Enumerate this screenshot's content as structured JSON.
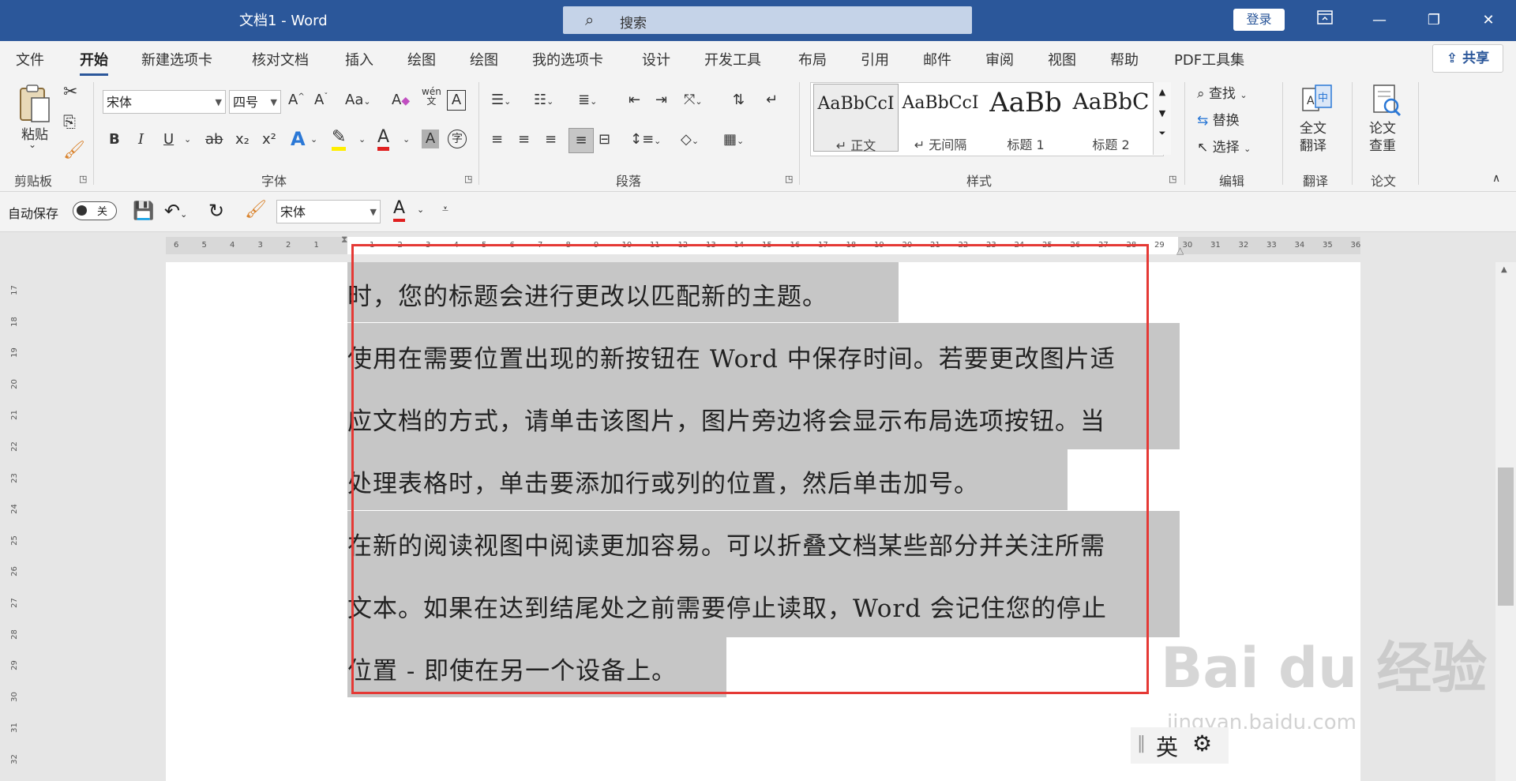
{
  "titlebar": {
    "doc_title": "文档1  -  Word",
    "search_placeholder": "搜索",
    "login": "登录",
    "ribbon_display_icon": "ribbon-display-icon",
    "minimize": "—",
    "restore": "❐",
    "close": "✕"
  },
  "tabs": [
    "文件",
    "开始",
    "新建选项卡",
    "核对文档",
    "插入",
    "绘图",
    "绘图",
    "我的选项卡",
    "设计",
    "开发工具",
    "布局",
    "引用",
    "邮件",
    "审阅",
    "视图",
    "帮助",
    "PDF工具集"
  ],
  "active_tab": "开始",
  "share": "共享",
  "ribbon": {
    "clipboard": {
      "paste": "粘贴",
      "label": "剪贴板"
    },
    "font": {
      "font_name": "宋体",
      "font_size": "四号",
      "bold": "B",
      "italic": "I",
      "underline": "U",
      "strike": "ab",
      "subscript": "x₂",
      "superscript": "x²",
      "phonetic": "wén",
      "label": "字体"
    },
    "paragraph": {
      "label": "段落"
    },
    "styles": {
      "items": [
        {
          "sample": "AaBbCcI",
          "name": "↵ 正文"
        },
        {
          "sample": "AaBbCcI",
          "name": "↵ 无间隔"
        },
        {
          "sample": "AaBb",
          "name": "标题 1"
        },
        {
          "sample": "AaBbC",
          "name": "标题 2"
        }
      ],
      "label": "样式"
    },
    "editing": {
      "find": "查找",
      "replace": "替换",
      "select": "选择",
      "label": "编辑"
    },
    "translate": {
      "button": "全文\n翻译",
      "label": "翻译"
    },
    "paper": {
      "button": "论文\n查重",
      "label": "论文"
    }
  },
  "qat": {
    "autosave_label": "自动保存",
    "autosave_state": "关",
    "font_name": "宋体"
  },
  "document": {
    "lines": [
      "时，您的标题会进行更改以匹配新的主题。",
      "使用在需要位置出现的新按钮在 Word 中保存时间。若要更改图片适",
      "应文档的方式，请单击该图片，图片旁边将会显示布局选项按钮。当",
      "处理表格时，单击要添加行或列的位置，然后单击加号。",
      "在新的阅读视图中阅读更加容易。可以折叠文档某些部分并关注所需",
      "文本。如果在达到结尾处之前需要停止读取，Word  会记住您的停止",
      "位置 - 即使在另一个设备上。"
    ]
  },
  "ruler": {
    "left_ticks": [
      "6",
      "5",
      "4",
      "3",
      "2",
      "1"
    ],
    "right_ticks": [
      "1",
      "2",
      "3",
      "4",
      "5",
      "6",
      "7",
      "8",
      "9",
      "10",
      "11",
      "12",
      "13",
      "14",
      "15",
      "16",
      "17",
      "18",
      "19",
      "20",
      "21",
      "22",
      "23",
      "24",
      "25",
      "26",
      "27",
      "28",
      "29",
      "30",
      "31",
      "32",
      "33",
      "34",
      "35",
      "36"
    ],
    "vertical_ticks": [
      "17",
      "18",
      "19",
      "20",
      "21",
      "22",
      "23",
      "24",
      "25",
      "26",
      "27",
      "28",
      "29",
      "30",
      "31",
      "32"
    ]
  },
  "ime": {
    "mode": "英"
  },
  "watermark": {
    "brand": "Bai du 经验",
    "url": "jingyan.baidu.com"
  },
  "colors": {
    "accent": "#2b579a",
    "highlight": "#c6c6c6",
    "selection_box": "#e53935"
  }
}
